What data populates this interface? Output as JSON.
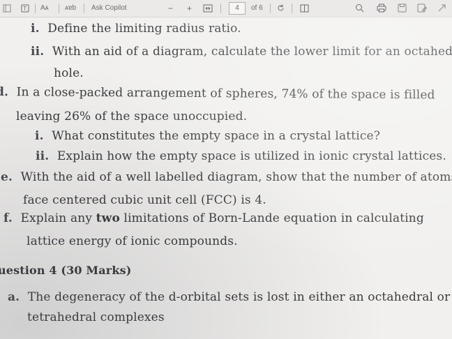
{
  "toolbar": {
    "font_size_label": "Aᴀ",
    "read_aloud_label": "ᴀɐb",
    "copilot_label": "Ask Copilot",
    "zoom_out": "−",
    "zoom_in": "+",
    "page_number": "4",
    "page_total": "of 6"
  },
  "document": {
    "q_c_i": {
      "marker": "i.",
      "text": "Define the limiting radius ratio."
    },
    "q_c_ii": {
      "marker": "ii.",
      "text": "With an aid of a diagram, calculate the lower limit for an octahedral",
      "cont": "hole."
    },
    "q_d": {
      "marker": "d.",
      "text": "In a close-packed arrangement of spheres, 74% of the space is filled",
      "cont": "leaving 26% of the space unoccupied."
    },
    "q_d_i": {
      "marker": "i.",
      "text": "What constitutes the empty space in a crystal lattice?"
    },
    "q_d_ii": {
      "marker": "ii.",
      "text": "Explain how the empty space is utilized in ionic crystal lattices."
    },
    "q_e": {
      "marker": "e.",
      "text": "With the aid of a well labelled diagram, show that the number of atoms in",
      "cont": "face centered cubic unit cell (FCC) is 4."
    },
    "q_f": {
      "marker": "f.",
      "text_before": "Explain any",
      "text_bold": "two",
      "text_after": "limitations of Born-Lande equation in calculating",
      "cont": "lattice energy of ionic compounds."
    },
    "q4_heading": "uestion 4 (30 Marks)",
    "q4_a": {
      "marker": "a.",
      "text": "The degeneracy of the d-orbital sets is lost in either an octahedral or",
      "cont": "tetrahedral complexes"
    }
  }
}
